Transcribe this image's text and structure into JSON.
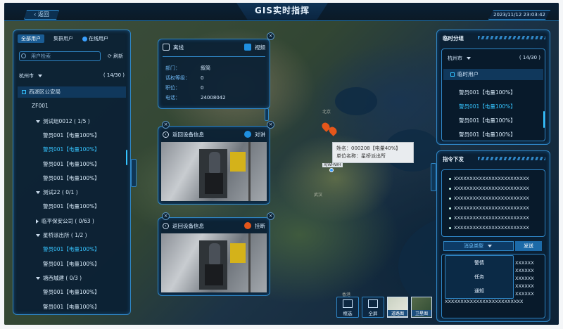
{
  "header": {
    "back_label": "返回",
    "title": "GIS实时指挥",
    "datetime": "2023/11/12 23:03:42"
  },
  "left_panel": {
    "tabs": [
      "全部用户",
      "集群用户"
    ],
    "online_label": "在线用户",
    "search_placeholder": "用户检索",
    "refresh_label": "刷新",
    "city": "杭州市",
    "count": "( 14/30 )",
    "tree": [
      {
        "text": "西湖区公安局",
        "type": "header"
      },
      {
        "text": "ZF001",
        "indent": 1
      },
      {
        "text": "测试组0012 ( 1/5 )",
        "indent": 2,
        "expand": "down"
      },
      {
        "text": "警员001【电量100%】",
        "indent": 3
      },
      {
        "text": "警员001【电量100%】",
        "indent": 3,
        "hl": true
      },
      {
        "text": "警员001【电量100%】",
        "indent": 3
      },
      {
        "text": "警员001【电量100%】",
        "indent": 3
      },
      {
        "text": "测试22 ( 0/1 )",
        "indent": 2,
        "expand": "down"
      },
      {
        "text": "警员001【电量100%】",
        "indent": 3
      },
      {
        "text": "临平保安公司 ( 0/63 )",
        "indent": 2,
        "expand": "right"
      },
      {
        "text": "星桥派出所 ( 1/2 )",
        "indent": 2,
        "expand": "down"
      },
      {
        "text": "警员001【电量100%】",
        "indent": 3,
        "hl": true
      },
      {
        "text": "警员001【电量100%】",
        "indent": 3
      },
      {
        "text": "塘西城建 ( 0/3 )",
        "indent": 2,
        "expand": "down"
      },
      {
        "text": "警员001【电量100%】",
        "indent": 3
      },
      {
        "text": "警员001【电量100%】",
        "indent": 3
      }
    ]
  },
  "info_card": {
    "status": "离线",
    "video_label": "视频",
    "fields": [
      {
        "k": "部门：",
        "v": "叙简"
      },
      {
        "k": "话权等级：",
        "v": "0"
      },
      {
        "k": "职位：",
        "v": "0"
      },
      {
        "k": "电话：",
        "v": "24008042"
      }
    ]
  },
  "video_card_1": {
    "title": "返回设备信息",
    "action": "对讲"
  },
  "video_card_2": {
    "title": "返回设备信息",
    "action": "挂断"
  },
  "map_popup": {
    "line1": "姓名：000208【电量40%】",
    "line2": "单位名称：星桥派出所",
    "marker_label": "XJWHWH"
  },
  "map_labels": [
    "北京",
    "上海",
    "武汉",
    "香港"
  ],
  "right_top": {
    "title": "临时分组",
    "city": "杭州市",
    "count": "( 14/30 )",
    "group": "临时用户",
    "items": [
      {
        "text": "警员001【电量100%】"
      },
      {
        "text": "警员001【电量100%】",
        "hl": true
      },
      {
        "text": "警员001【电量100%】"
      },
      {
        "text": "警员001【电量100%】"
      }
    ]
  },
  "right_bot": {
    "title": "指令下发",
    "lines": [
      "XXXXXXXXXXXXXXXXXXXXXXXX",
      "XXXXXXXXXXXXXXXXXXXXXXXX",
      "XXXXXXXXXXXXXXXXXXXXXXXX",
      "XXXXXXXXXXXXXXXXXXXXXXXX",
      "XXXXXXXXXXXXXXXXXXXXXXXX",
      "XXXXXXXXXXXXXXXXXXXXXXXX"
    ],
    "msg_type": "消息类型",
    "send": "发送",
    "menu": [
      "警情",
      "任务",
      "通知"
    ],
    "input_lines": [
      "XXXXXX",
      "XXXXXX",
      "XXXXXX",
      "XXXXXX",
      "XXXXXX",
      "XXXXXXXXXXXXXXXXXXXXXXXXX"
    ]
  },
  "toolbar": {
    "select": "框选",
    "fullscreen": "全屏",
    "road_map": "道路图",
    "satellite": "卫星图"
  },
  "colors": {
    "accent": "#2f86c6",
    "highlight": "#35c4ff",
    "marker": "#e5561a"
  }
}
